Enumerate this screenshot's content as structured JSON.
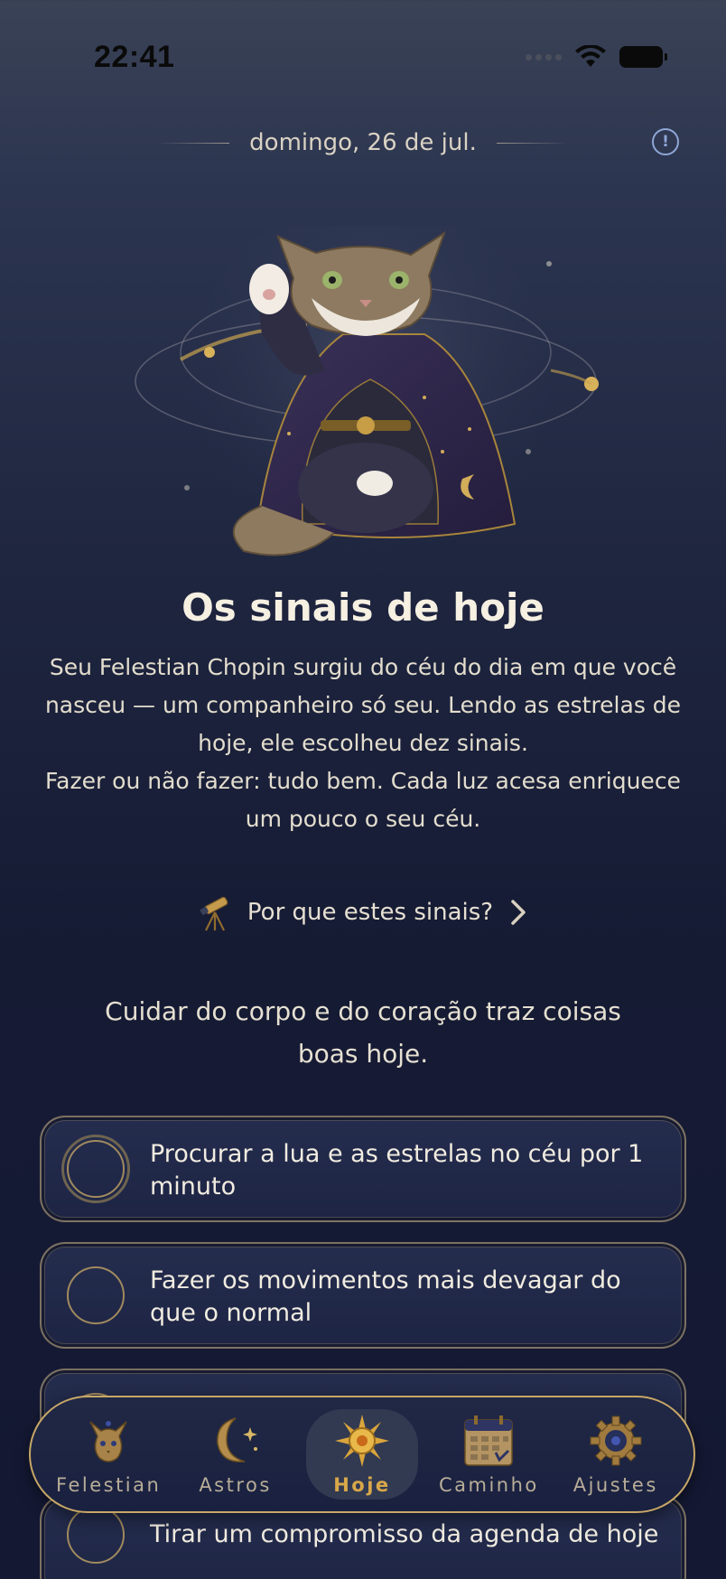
{
  "status_bar": {
    "time": "22:41"
  },
  "header": {
    "date": "domingo, 26 de jul."
  },
  "hero": {
    "title": "Os sinais de hoje"
  },
  "intro": {
    "paragraph1": "Seu Felestian Chopin surgiu do céu do dia em que você nasceu — um companheiro só seu. Lendo as estrelas de hoje, ele escolheu dez sinais.",
    "paragraph2": "Fazer ou não fazer: tudo bem. Cada luz acesa enriquece um pouco o seu céu."
  },
  "why_link": {
    "label": "Por que estes sinais?"
  },
  "subtitle": "Cuidar do corpo e do coração traz coisas boas hoje.",
  "tasks": [
    {
      "label": "Procurar a lua e as estrelas no céu por 1 minuto",
      "checked": false
    },
    {
      "label": "Fazer os movimentos mais devagar do que o normal",
      "checked": false
    },
    {
      "label": "",
      "checked": false
    },
    {
      "label": "Tirar um compromisso da agenda de hoje",
      "checked": false
    }
  ],
  "nav": {
    "items": [
      {
        "label": "Felestian",
        "icon": "cat-crest-icon",
        "active": false
      },
      {
        "label": "Astros",
        "icon": "crescent-moon-icon",
        "active": false
      },
      {
        "label": "Hoje",
        "icon": "sun-icon",
        "active": true
      },
      {
        "label": "Caminho",
        "icon": "calendar-icon",
        "active": false
      },
      {
        "label": "Ajustes",
        "icon": "gear-icon",
        "active": false
      }
    ]
  },
  "colors": {
    "accent": "#d8a849",
    "card_border": "#c7a766",
    "background": "#161b34",
    "info": "#8ea7d6"
  }
}
